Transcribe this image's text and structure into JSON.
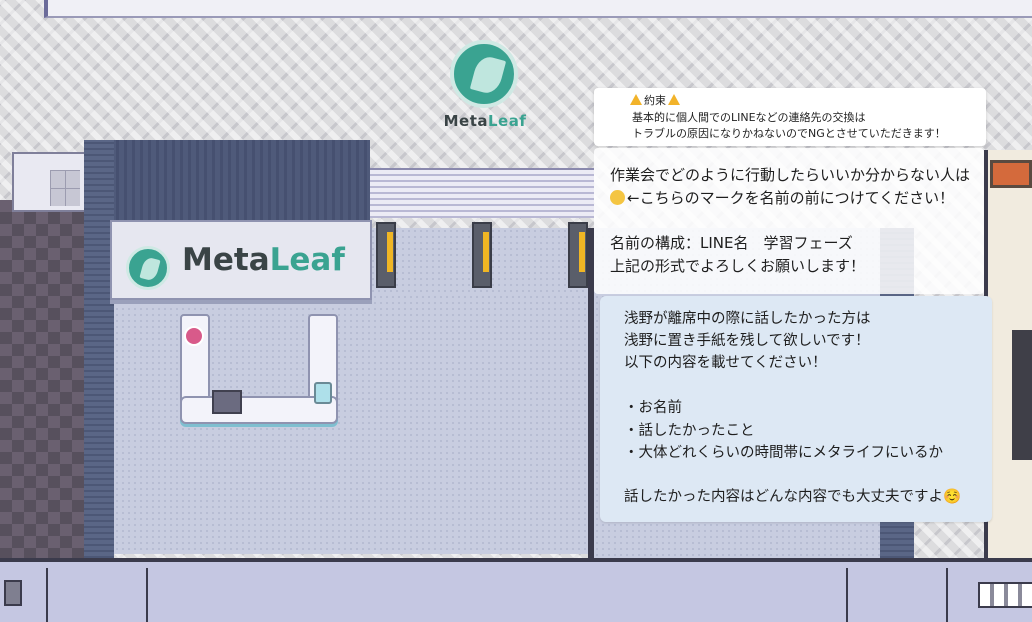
{
  "floor_logo": {
    "word_a": "Meta",
    "word_b": "Leaf"
  },
  "sign": {
    "word_a": "Meta",
    "word_b": "Leaf"
  },
  "notice_top": {
    "title": "約束",
    "line1": "基本的に個人間でのLINEなどの連絡先の交換は",
    "line2": "トラブルの原因になりかねないのでNGとさせていただきます！"
  },
  "notice_mid": {
    "line1": "作業会でどのように行動したらいいか分からない人は",
    "line2": "←こちらのマークを名前の前につけてください！",
    "line3": "名前の構成：LINE名　学習フェーズ",
    "line4": "上記の形式でよろしくお願いします！"
  },
  "notice_bottom": {
    "line1": "浅野が離席中の際に話したかった方は",
    "line2": "浅野に置き手紙を残して欲しいです！",
    "line3": "以下の内容を載せてください！",
    "item1": "・お名前",
    "item2": "・話したかったこと",
    "item3": "・大体どれくらいの時間帯にメタライフにいるか",
    "closing": "話したかった内容はどんな内容でも大丈夫ですよ☺️"
  },
  "colors": {
    "brand": "#3aa391",
    "warning": "#f2b32a",
    "board_blue": "#dde8f4"
  },
  "icons": [
    "leaf-logo-icon",
    "warning-icon",
    "face-emoji-icon"
  ]
}
